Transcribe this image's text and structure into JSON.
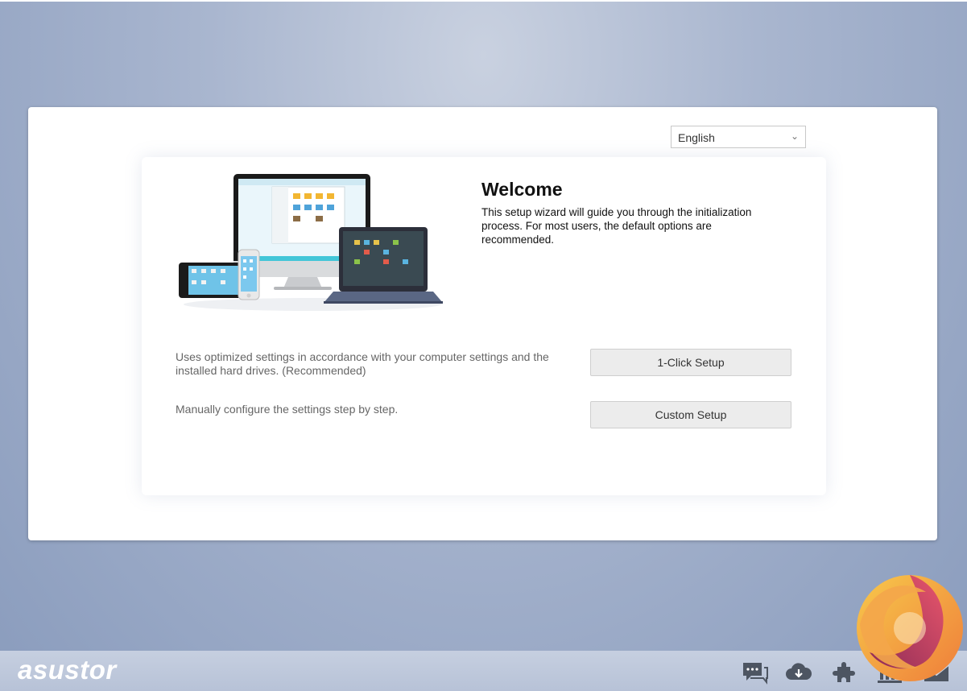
{
  "language": {
    "selected": "English"
  },
  "welcome": {
    "title": "Welcome",
    "description": "This setup wizard will guide you through the initialization process. For most users, the default options are recommended."
  },
  "options": [
    {
      "description": "Uses optimized settings in accordance with your computer settings and the installed hard drives. (Recommended)",
      "button": "1-Click Setup"
    },
    {
      "description": "Manually configure the settings step by step.",
      "button": "Custom Setup"
    }
  ],
  "footer": {
    "brand": "asustor",
    "icons": [
      "chat-icon",
      "cloud-download-icon",
      "plugin-icon",
      "app-central-icon",
      "mail-icon"
    ]
  },
  "colors": {
    "background": "#a9b6cf",
    "panel": "#ffffff",
    "button": "#ececec"
  }
}
